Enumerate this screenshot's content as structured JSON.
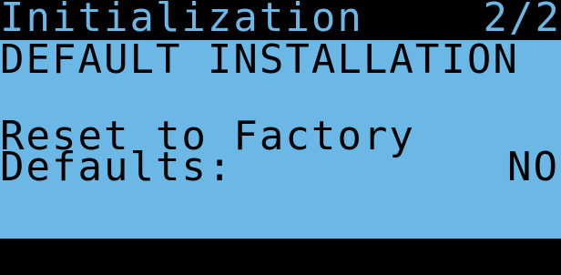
{
  "screen": {
    "title": "Initialization",
    "page_indicator": "2/2",
    "section_heading": "DEFAULT INSTALLATION",
    "setting_label_line1": "Reset to Factory",
    "setting_label_line2": "Defaults:",
    "setting_value": "NO"
  },
  "colors": {
    "background": "#6bb8e6",
    "foreground": "#000000"
  }
}
